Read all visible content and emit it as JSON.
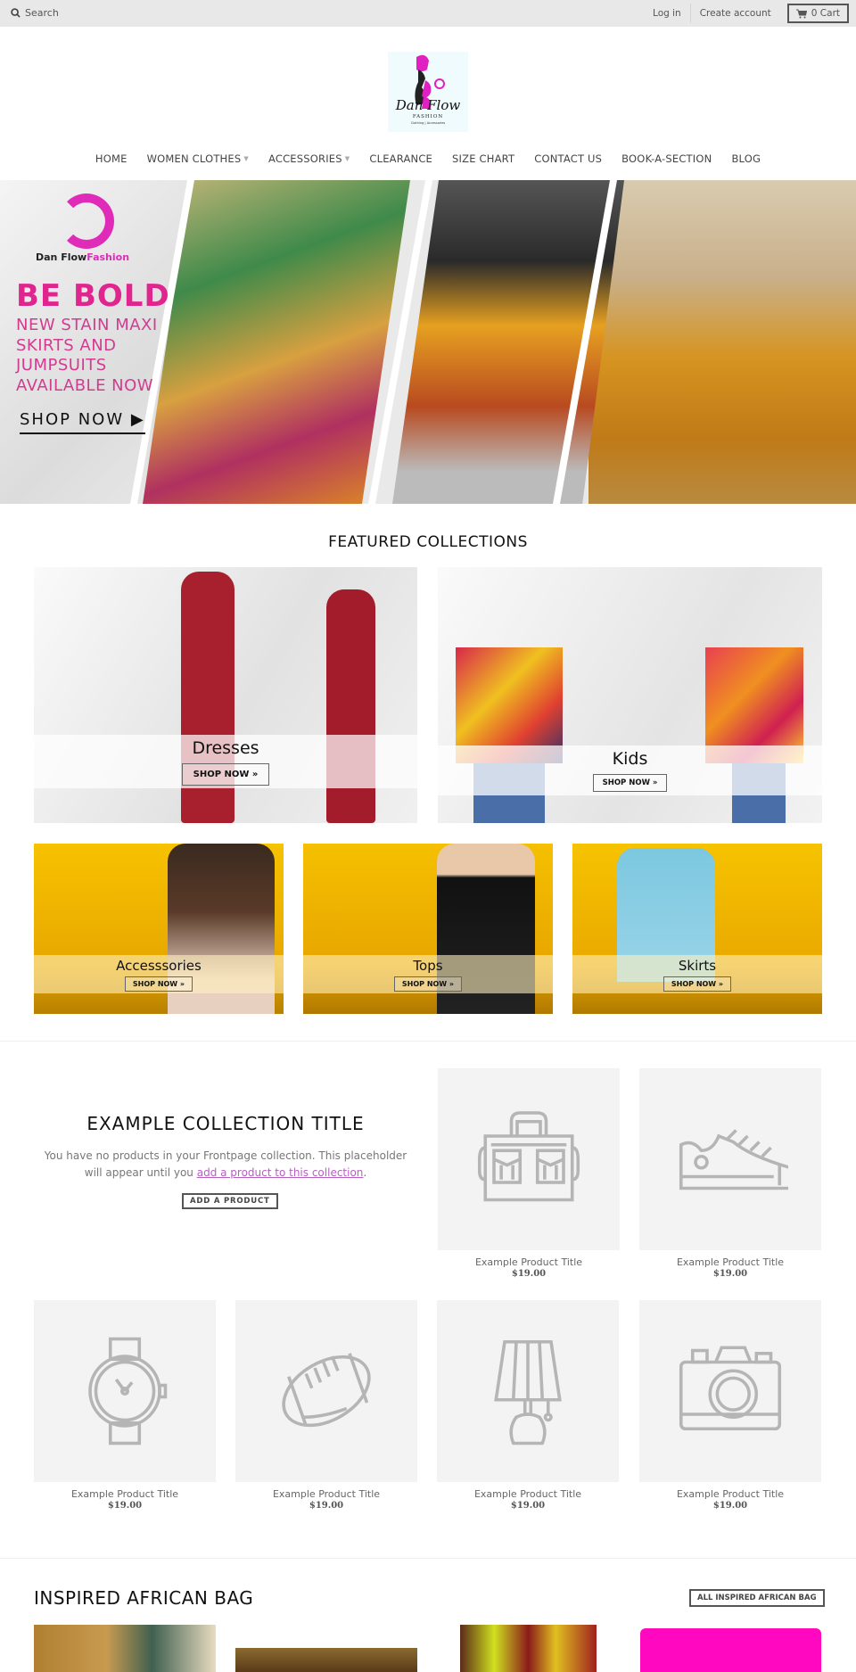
{
  "topbar": {
    "search_label": "Search",
    "login": "Log in",
    "create_account": "Create account",
    "cart_label": "0 Cart"
  },
  "logo": {
    "alt": "Dan Flow Fashion",
    "name": "Dan Flow",
    "tagline": "FASHION",
    "sub": "Clothing | Accessories"
  },
  "nav": {
    "items": [
      {
        "label": "HOME",
        "dropdown": false
      },
      {
        "label": "WOMEN CLOTHES",
        "dropdown": true
      },
      {
        "label": "ACCESSORIES",
        "dropdown": true
      },
      {
        "label": "CLEARANCE",
        "dropdown": false
      },
      {
        "label": "SIZE CHART",
        "dropdown": false
      },
      {
        "label": "CONTACT US",
        "dropdown": false
      },
      {
        "label": "BOOK-A-SECTION",
        "dropdown": false
      },
      {
        "label": "BLOG",
        "dropdown": false
      }
    ]
  },
  "hero": {
    "brand_a": "Dan Flow",
    "brand_b": "Fashion",
    "headline": "BE BOLD",
    "subtext": "NEW STAIN MAXI SKIRTS AND JUMPSUITS AVAILABLE NOW",
    "cta": "SHOP NOW",
    "accent": "#e0258f"
  },
  "featured": {
    "title": "FEATURED COLLECTIONS",
    "large": [
      {
        "label": "Dresses",
        "cta": "SHOP NOW »"
      },
      {
        "label": "Kids",
        "cta": "SHOP NOW »"
      }
    ],
    "small": [
      {
        "label": "Accesssories",
        "cta": "SHOP NOW »"
      },
      {
        "label": "Tops",
        "cta": "SHOP NOW »"
      },
      {
        "label": "Skirts",
        "cta": "SHOP NOW »"
      }
    ]
  },
  "example_collection": {
    "title": "EXAMPLE COLLECTION TITLE",
    "text_before": "You have no products in your Frontpage collection. This placeholder will appear until you ",
    "link_text": "add a product to this collection",
    "text_after": ".",
    "button": "ADD A PRODUCT",
    "products": [
      {
        "title": "Example Product Title",
        "price": "$19.00",
        "icon": "bag-icon"
      },
      {
        "title": "Example Product Title",
        "price": "$19.00",
        "icon": "sneaker-icon"
      },
      {
        "title": "Example Product Title",
        "price": "$19.00",
        "icon": "watch-icon"
      },
      {
        "title": "Example Product Title",
        "price": "$19.00",
        "icon": "football-icon"
      },
      {
        "title": "Example Product Title",
        "price": "$19.00",
        "icon": "lamp-icon"
      },
      {
        "title": "Example Product Title",
        "price": "$19.00",
        "icon": "camera-icon"
      }
    ]
  },
  "bag_section": {
    "title": "INSPIRED AFRICAN BAG",
    "button": "ALL INSPIRED AFRICAN BAG"
  }
}
